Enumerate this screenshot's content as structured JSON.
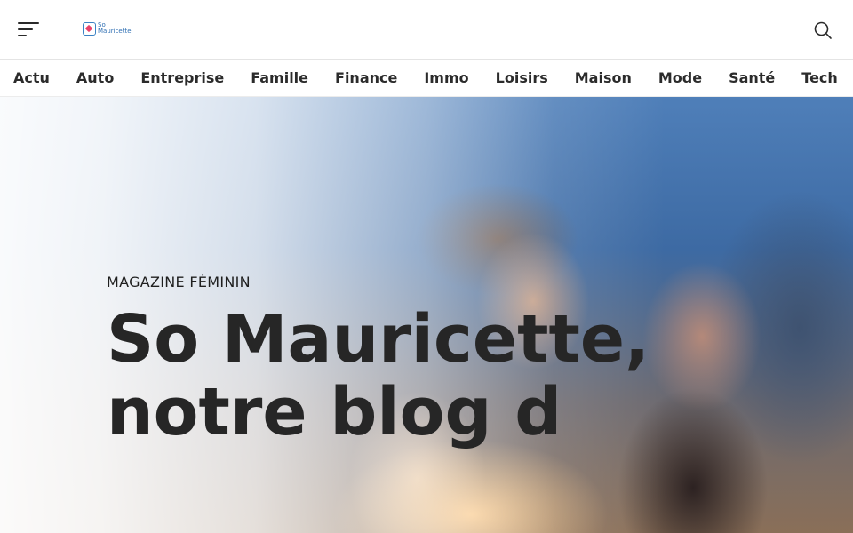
{
  "header": {
    "logo_text": "So Mauricette",
    "menu_icon": "hamburger-menu-icon",
    "search_icon": "search-icon"
  },
  "categories": [
    "Actu",
    "Auto",
    "Entreprise",
    "Famille",
    "Finance",
    "Immo",
    "Loisirs",
    "Maison",
    "Mode",
    "Santé",
    "Tech"
  ],
  "hero": {
    "kicker": "MAGAZINE FÉMININ",
    "title": "So Mauricette, notre blog d"
  },
  "colors": {
    "logo_blue": "#3b82c4",
    "logo_pink": "#e9416b",
    "text_dark": "#262626"
  }
}
